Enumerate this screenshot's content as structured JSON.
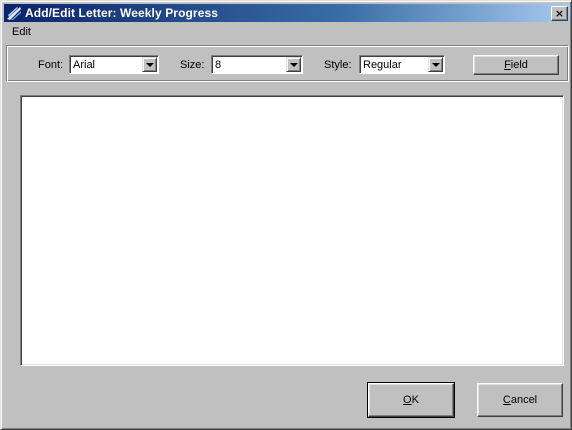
{
  "window": {
    "title": "Add/Edit Letter: Weekly Progress",
    "close_symbol": "×"
  },
  "menubar": {
    "items": [
      "Edit"
    ]
  },
  "toolbar": {
    "font_label": "Font:",
    "font_value": "Arial",
    "size_label": "Size:",
    "size_value": "8",
    "style_label": "Style:",
    "style_value": "Regular",
    "field_button": {
      "mnemonic": "F",
      "rest": "ield"
    }
  },
  "editor": {
    "content": ""
  },
  "buttons": {
    "ok": {
      "mnemonic": "O",
      "rest": "K"
    },
    "cancel": {
      "mnemonic": "C",
      "rest": "ancel"
    }
  }
}
